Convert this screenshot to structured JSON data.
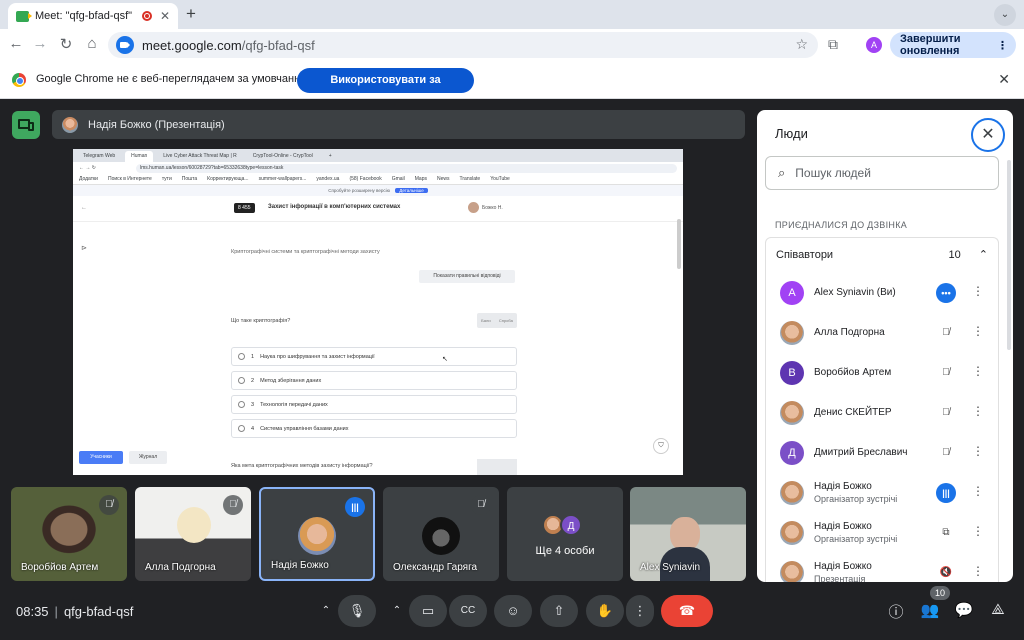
{
  "browser": {
    "tab_title": "Meet: \"qfg-bfad-qsf\"",
    "tab_close": "✕",
    "new_tab": "+",
    "url_host": "meet.google.com",
    "url_path": "/qfg-bfad-qsf",
    "profile_initial": "A",
    "update_button": "Завершити оновлення",
    "infobar_message": "Google Chrome не є веб-переглядачем за умовчанням",
    "infobar_button": "Використовувати за умовчанням"
  },
  "presentation": {
    "presenter_label": "Надія Божко (Презентація)"
  },
  "shared_screen": {
    "tabs": [
      "Telegram Web",
      "Human",
      "Live Cyber Attack Threat Map | R",
      "CrypTool-Online - CrypTool"
    ],
    "url": "lms.human.ua/lesson/60028729?tab=65332638type=lesson-task",
    "bookmarks": [
      "Додатки",
      "Поиск в Интернете",
      "тути",
      "Пошта",
      "Корректирующа...",
      "summer-wallpapers...",
      "yandex.ua",
      "(58) Facebook",
      "Gmail",
      "Maps",
      "News",
      "Translate",
      "YouTube"
    ],
    "banner_text": "Спробуйте розширену версію",
    "banner_button": "Детальніше",
    "course_code": "8 455",
    "course_title": "Захист інформації в комп'ютерних системах",
    "user_name": "Божко Н.",
    "subtitle": "Криптографічні системи та криптографічні методи захисту",
    "show_answers": "Показати правильні відповіді",
    "question": "Що таке криптографія?",
    "score_labels": [
      "Бали",
      "Спроба"
    ],
    "options": [
      {
        "num": "1",
        "text": "Наука про шифрування та захист інформації"
      },
      {
        "num": "2",
        "text": "Метод зберігання даних"
      },
      {
        "num": "3",
        "text": "Технологія передачі даних"
      },
      {
        "num": "4",
        "text": "Система управління базами даних"
      }
    ],
    "next_question": "Яка мета криптографічних методів захисту інформації?",
    "btn_students": "Учасники",
    "btn_journal": "Журнал"
  },
  "tiles": [
    {
      "name": "Воробйов Артем"
    },
    {
      "name": "Алла Подгорна"
    },
    {
      "name": "Надія Божко"
    },
    {
      "name": "Олександр Гаряга"
    },
    {
      "name": "Ще 4 особи",
      "initial": "Д"
    },
    {
      "name": "Alex Syniavin"
    }
  ],
  "bottom": {
    "time": "08:35",
    "meeting_code": "qfg-bfad-qsf",
    "people_count": "10"
  },
  "people_panel": {
    "title": "Люди",
    "search_placeholder": "Пошук людей",
    "joined_label": "ПРИЄДНАЛИСЯ ДО ДЗВІНКА",
    "group_name": "Співавтори",
    "group_count": "10",
    "participants": [
      {
        "name": "Alex Syniavin (Ви)",
        "initial": "A",
        "color": "#a142f4",
        "status": "more"
      },
      {
        "name": "Алла Подгорна",
        "photo": true,
        "status": "muted"
      },
      {
        "name": "Воробйов Артем",
        "initial": "В",
        "color": "#5e35b1",
        "status": "muted"
      },
      {
        "name": "Денис СКЕЙТЕР",
        "photo": true,
        "status": "muted"
      },
      {
        "name": "Дмитрий Бреславич",
        "initial": "Д",
        "color": "#7b4fc7",
        "status": "muted"
      },
      {
        "name": "Надія Божко",
        "role": "Організатор зустрічі",
        "photo": true,
        "status": "speaking"
      },
      {
        "name": "Надія Божко",
        "role": "Організатор зустрічі",
        "photo": true,
        "status": "presenting"
      },
      {
        "name": "Надія Божко",
        "role": "Презентація",
        "photo": true,
        "status": "muted-audio"
      }
    ]
  },
  "colors": {
    "meet_bg": "#202124",
    "accent": "#1a73e8",
    "hangup": "#ea4335",
    "present_green": "#3fa85f"
  }
}
